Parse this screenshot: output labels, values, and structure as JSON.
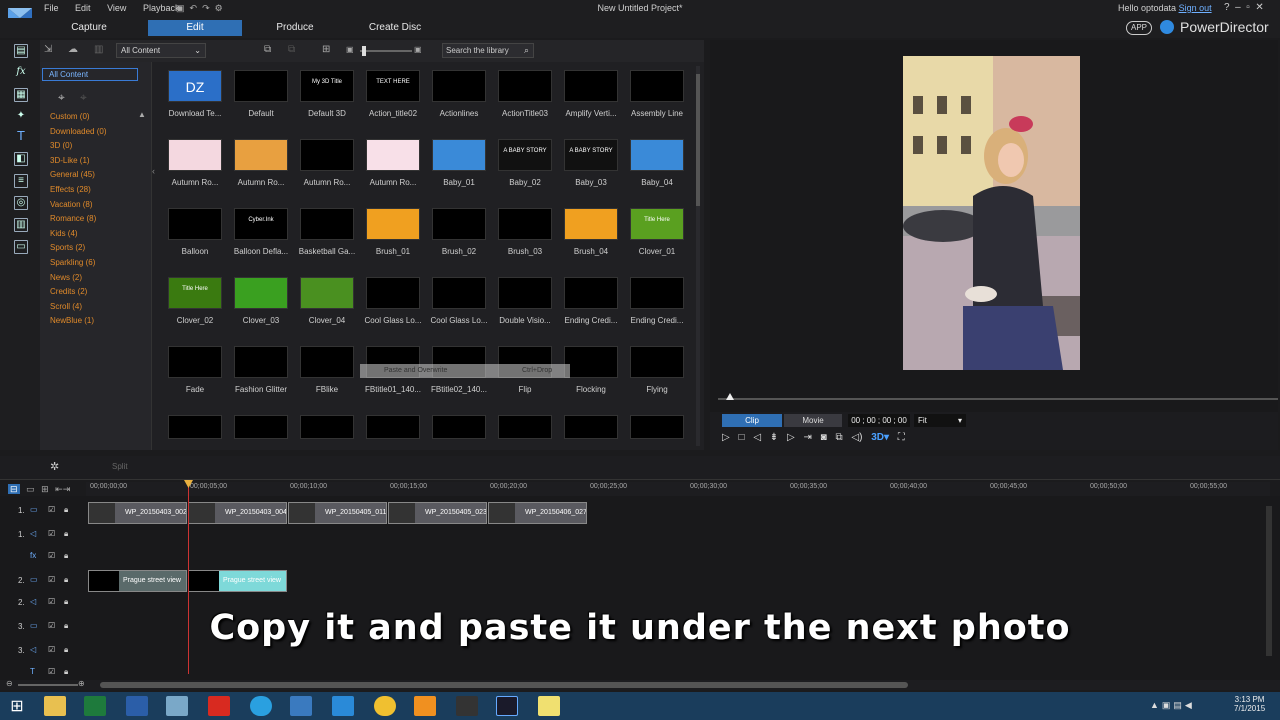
{
  "window": {
    "menu": [
      "File",
      "Edit",
      "View",
      "Playback"
    ],
    "title": "New Untitled Project*",
    "user": "Hello optodata",
    "signout": "Sign out",
    "app_badge": "APP",
    "brand": "PowerDirector"
  },
  "modes": [
    "Capture",
    "Edit",
    "Produce",
    "Create Disc"
  ],
  "library": {
    "filter_value": "All Content",
    "search_placeholder": "Search the library",
    "selected_category": "All Content",
    "categories": [
      "Custom  (0)",
      "Downloaded  (0)",
      "3D  (0)",
      "3D-Like  (1)",
      "General  (45)",
      "Effects  (28)",
      "Vacation  (8)",
      "Romance  (8)",
      "Kids  (4)",
      "Sports  (2)",
      "Sparkling  (6)",
      "News  (2)",
      "Credits  (2)",
      "Scroll  (4)",
      "NewBlue  (1)"
    ],
    "templates": [
      "Download Te...",
      "Default",
      "Default 3D",
      "Action_title02",
      "Actionlines",
      "ActionTitle03",
      "Amplify Verti...",
      "Assembly Line",
      "Autumn Ro...",
      "Autumn Ro...",
      "Autumn Ro...",
      "Autumn Ro...",
      "Baby_01",
      "Baby_02",
      "Baby_03",
      "Baby_04",
      "Balloon",
      "Balloon Defla...",
      "Basketball Ga...",
      "Brush_01",
      "Brush_02",
      "Brush_03",
      "Brush_04",
      "Clover_01",
      "Clover_02",
      "Clover_03",
      "Clover_04",
      "Cool Glass Lo...",
      "Cool Glass Lo...",
      "Double Visio...",
      "Ending Credi...",
      "Ending Credi...",
      "Fade",
      "Fashion Glitter",
      "FBlike",
      "FBtitle01_140...",
      "FBtitle02_140...",
      "Flip",
      "Flocking",
      "Flying"
    ],
    "tile_texts": [
      "DZ",
      "",
      "My 3D Title",
      "TEXT HERE",
      "",
      "",
      "",
      "",
      "",
      "",
      "",
      "",
      "",
      "A BABY STORY",
      "A BABY STORY",
      "",
      "",
      "Cyber.Ink",
      "",
      "",
      "",
      "",
      "",
      "Title Here",
      "Title Here",
      "",
      "",
      "",
      "",
      "",
      "",
      ""
    ],
    "drag_tooltip": {
      "left": "Paste and Overwrite",
      "right": "Ctrl+Drop"
    }
  },
  "preview": {
    "clip_label": "Clip",
    "movie_label": "Movie",
    "timecode": "00 ; 00 ; 00 ; 00",
    "fit": "Fit"
  },
  "timeline": {
    "split": "Split",
    "ruler": [
      "00;00;00;00",
      "00;00;05;00",
      "00;00;10;00",
      "00;00;15;00",
      "00;00;20;00",
      "00;00;25;00",
      "00;00;30;00",
      "00;00;35;00",
      "00;00;40;00",
      "00;00;45;00",
      "00;00;50;00",
      "00;00;55;00"
    ],
    "tracks": [
      "1.",
      "1.",
      "",
      "2.",
      "2.",
      "3.",
      "3.",
      ""
    ],
    "video_clips": [
      "WP_20150403_002",
      "WP_20150403_004",
      "WP_20150405_011",
      "WP_20150405_023",
      "WP_20150406_027"
    ],
    "title_clips": [
      "Prague street view",
      "Prague street view"
    ]
  },
  "caption": "Copy it and paste it under the next photo",
  "clock": {
    "time": "3:13 PM",
    "date": "7/1/2015"
  },
  "colors": {
    "accent": "#2f6fb4",
    "category": "#e08a2a",
    "title_clip": "#7ed9d9"
  }
}
